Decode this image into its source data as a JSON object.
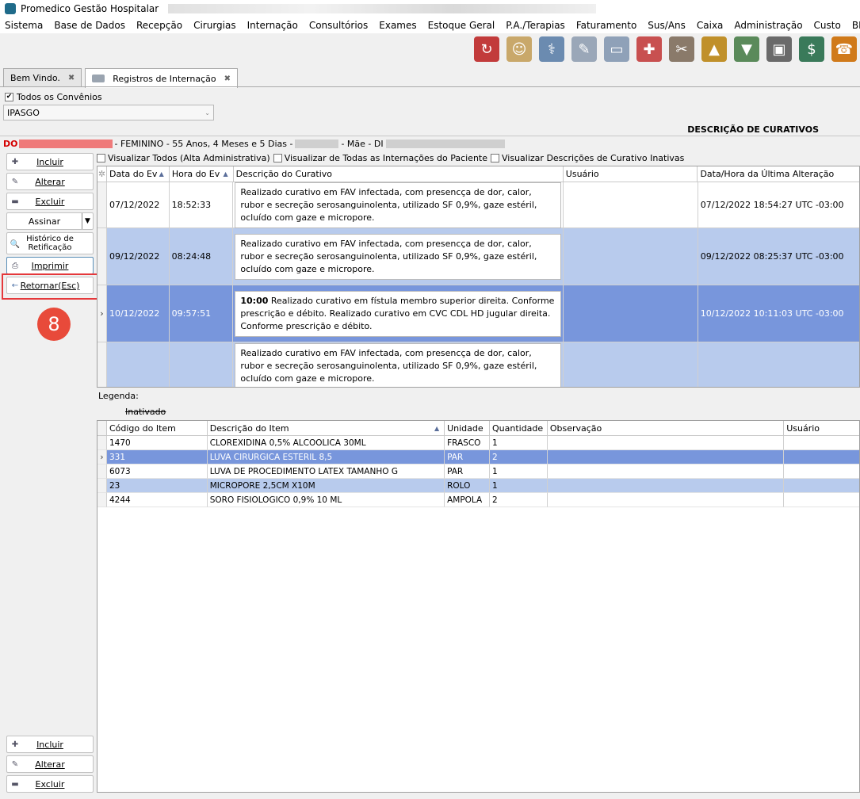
{
  "window": {
    "title": "Promedico Gestão Hospitalar"
  },
  "menu": [
    "Sistema",
    "Base de Dados",
    "Recepção",
    "Cirurgias",
    "Internação",
    "Consultórios",
    "Exames",
    "Estoque Geral",
    "P.A./Terapias",
    "Faturamento",
    "Sus/Ans",
    "Caixa",
    "Administração",
    "Custo",
    "BI"
  ],
  "toolbar": [
    {
      "icon": "sync-users-icon",
      "color": "#c23b3b",
      "glyph": "↻"
    },
    {
      "icon": "doctors-icon",
      "color": "#c9a86a",
      "glyph": "☺"
    },
    {
      "icon": "physician-icon",
      "color": "#6b8bb0",
      "glyph": "⚕"
    },
    {
      "icon": "document-sign-icon",
      "color": "#9aa7b8",
      "glyph": "✎"
    },
    {
      "icon": "hospital-bed-icon",
      "color": "#8fa1b8",
      "glyph": "▭"
    },
    {
      "icon": "ambulance-icon",
      "color": "#c85050",
      "glyph": "✚"
    },
    {
      "icon": "medical-supplies-icon",
      "color": "#8a7a6a",
      "glyph": "✂"
    },
    {
      "icon": "stock-up-icon",
      "color": "#c0902a",
      "glyph": "▲"
    },
    {
      "icon": "stock-down-icon",
      "color": "#5a8a5a",
      "glyph": "▼"
    },
    {
      "icon": "safe-icon",
      "color": "#6a6a6a",
      "glyph": "▣"
    },
    {
      "icon": "billing-icon",
      "color": "#3a7a5a",
      "glyph": "$"
    },
    {
      "icon": "phone-icon",
      "color": "#d07a1a",
      "glyph": "☎"
    }
  ],
  "tabs": [
    {
      "label": "Bem Vindo."
    },
    {
      "label": "Registros de Internação"
    }
  ],
  "filters": {
    "todos_convenios_label": "Todos os Convênios",
    "todos_convenios_checked": true,
    "convenio_value": "IPASGO"
  },
  "section_title": "DESCRIÇÃO DE CURATIVOS",
  "patient": {
    "prefix": "DO",
    "info": "- FEMININO - 55 Anos, 4 Meses e 5 Dias -",
    "mae_label": "- Mãe - DI"
  },
  "sidebar": {
    "incluir": "Incluir",
    "alterar": "Alterar",
    "excluir": "Excluir",
    "assinar": "Assinar",
    "historico": "Histórico de Retificação",
    "imprimir": "Imprimir",
    "retornar": "Retornar(Esc)"
  },
  "annotation_badge": "8",
  "options": {
    "visualizar_todos": "Visualizar Todos (Alta Administrativa)",
    "visualizar_internacoes": "Visualizar de Todas as Internações do Paciente",
    "visualizar_inativas": "Visualizar Descrições de Curativo Inativas"
  },
  "curativos": {
    "columns": [
      "Data do Ev",
      "Hora do Ev",
      "Descrição do Curativo",
      "Usuário",
      "Data/Hora da Última Alteração"
    ],
    "rows": [
      {
        "data": "07/12/2022",
        "hora": "18:52:33",
        "bold": "",
        "descricao": "Realizado curativo em FAV infectada, com presencça de dor, calor, rubor e secreção serosanguinolenta, utilizado SF 0,9%, gaze estéril, ocluído com gaze e micropore.",
        "usuario": "",
        "alteracao": "07/12/2022 18:54:27 UTC -03:00"
      },
      {
        "data": "09/12/2022",
        "hora": "08:24:48",
        "bold": "",
        "descricao": "Realizado curativo em FAV infectada, com presencça de dor, calor, rubor e secreção serosanguinolenta, utilizado SF 0,9%, gaze estéril, ocluído com gaze e micropore.",
        "usuario": "",
        "alteracao": "09/12/2022 08:25:37 UTC -03:00"
      },
      {
        "data": "10/12/2022",
        "hora": "09:57:51",
        "bold": "10:00",
        "descricao": " Realizado curativo em fístula membro superior direita. Conforme prescrição e débito. Realizado curativo em CVC CDL HD jugular direita. Conforme prescrição e débito.",
        "usuario": "",
        "alteracao": "10/12/2022 10:11:03 UTC -03:00"
      },
      {
        "data": "",
        "hora": "",
        "bold": "",
        "descricao": "Realizado curativo em FAV infectada, com presencça de dor, calor, rubor e secreção serosanguinolenta, utilizado SF 0,9%, gaze estéril, ocluído com gaze e micropore.",
        "usuario": "",
        "alteracao": ""
      }
    ]
  },
  "legenda_label": "Legenda:",
  "inativado_label": "Inativado",
  "itens": {
    "columns": [
      "Código do Item",
      "Descrição do Item",
      "Unidade",
      "Quantidade",
      "Observação",
      "Usuário"
    ],
    "rows": [
      {
        "codigo": "1470",
        "descricao": "CLOREXIDINA 0,5% ALCOOLICA 30ML",
        "unidade": "FRASCO",
        "quantidade": "1",
        "observacao": "",
        "usuario": ""
      },
      {
        "codigo": "331",
        "descricao": "LUVA CIRURGICA ESTERIL 8,5",
        "unidade": "PAR",
        "quantidade": "2",
        "observacao": "",
        "usuario": ""
      },
      {
        "codigo": "6073",
        "descricao": "LUVA DE PROCEDIMENTO LATEX TAMANHO G",
        "unidade": "PAR",
        "quantidade": "1",
        "observacao": "",
        "usuario": ""
      },
      {
        "codigo": "23",
        "descricao": "MICROPORE 2,5CM X10M",
        "unidade": "ROLO",
        "quantidade": "1",
        "observacao": "",
        "usuario": ""
      },
      {
        "codigo": "4244",
        "descricao": "SORO FISIOLOGICO 0,9% 10 ML",
        "unidade": "AMPOLA",
        "quantidade": "2",
        "observacao": "",
        "usuario": ""
      }
    ]
  },
  "bottom_buttons": {
    "incluir": "Incluir",
    "alterar": "Alterar",
    "excluir": "Excluir"
  }
}
